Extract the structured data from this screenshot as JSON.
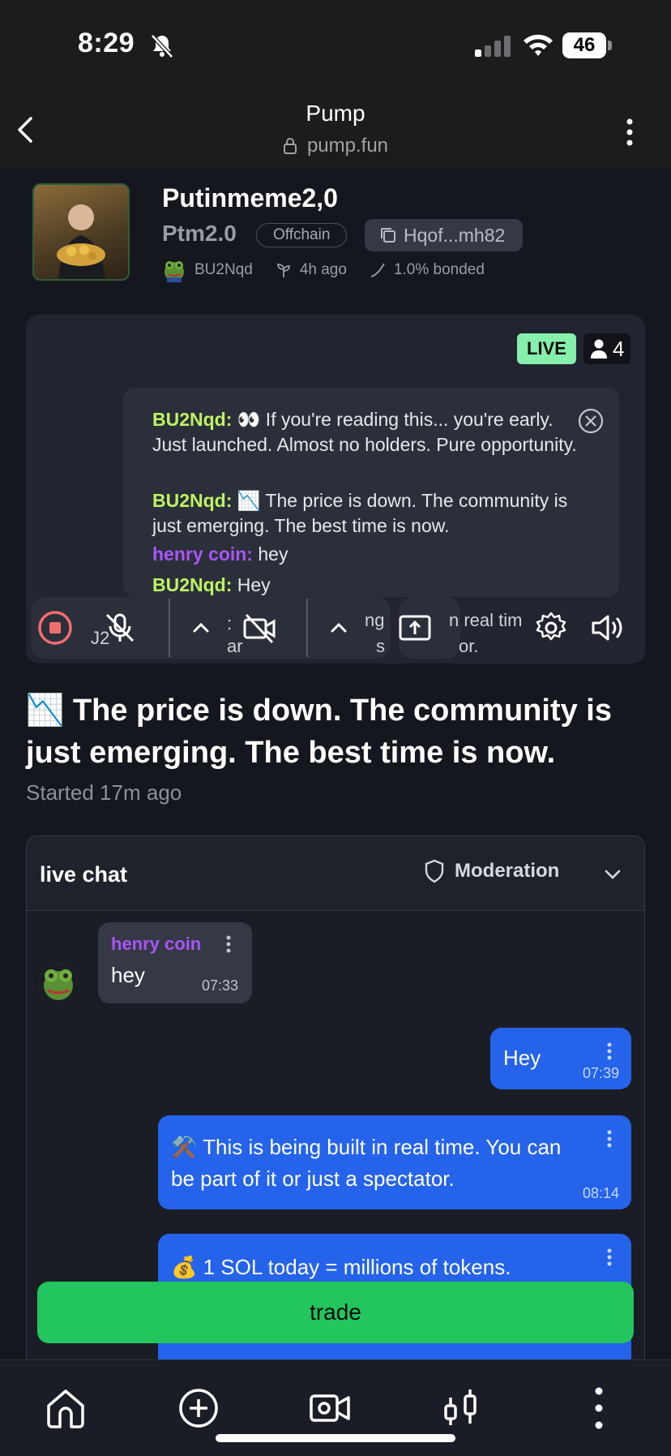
{
  "status_bar": {
    "time": "8:29",
    "battery": "46"
  },
  "browser": {
    "title": "Pump",
    "url": "pump.fun"
  },
  "token": {
    "name": "Putinmeme2,0",
    "ticker": "Ptm2.0",
    "offchain_label": "Offchain",
    "contract_short": "Hqof...mh82",
    "creator": "BU2Nqd",
    "age": "4h ago",
    "bonded": "1.0% bonded"
  },
  "stream": {
    "live_label": "LIVE",
    "viewer_count": "4",
    "overlay_messages": [
      {
        "user": "BU2Nqd:",
        "text": "👀 If you're reading this... you're early. Just launched. Almost no holders. Pure opportunity."
      },
      {
        "user": "BU2Nqd:",
        "text": "📉 The price is down. The community is just emerging. The best time is now."
      },
      {
        "user": "henry coin:",
        "text": "hey"
      },
      {
        "user": "BU2Nqd:",
        "text": "Hey"
      }
    ],
    "partial_under_controls": [
      "J2",
      ":",
      "ar",
      "ng",
      "s",
      "n real tim",
      "or."
    ]
  },
  "headline": "📉 The price is down. The community is just emerging. The best time is now.",
  "started": "Started 17m ago",
  "chat": {
    "title": "live chat",
    "moderation_label": "Moderation",
    "messages": [
      {
        "user": "henry coin",
        "text": "hey",
        "time": "07:33"
      },
      {
        "text": "Hey",
        "time": "07:39"
      },
      {
        "text": "⚒️ This is being built in real time. You can be part of it or just a spectator.",
        "time": "08:14"
      },
      {
        "text": "💰 1 SOL today = millions of tokens."
      }
    ]
  },
  "trade_label": "trade"
}
